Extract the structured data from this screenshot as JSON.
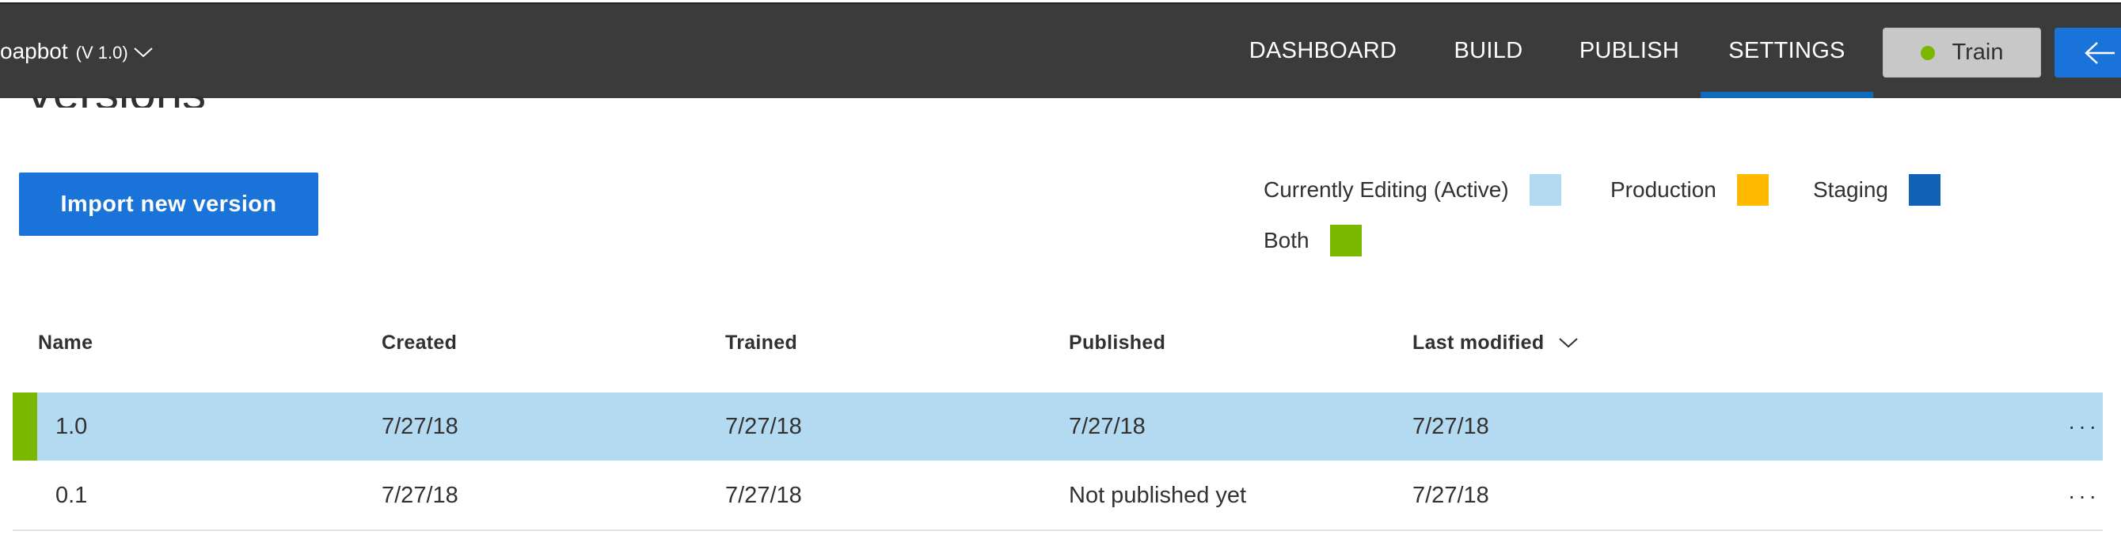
{
  "header": {
    "app_name": "oapbot",
    "version": "(V 1.0)",
    "tabs": [
      {
        "label": "DASHBOARD",
        "active": false
      },
      {
        "label": "BUILD",
        "active": false
      },
      {
        "label": "PUBLISH",
        "active": false
      },
      {
        "label": "SETTINGS",
        "active": true
      }
    ],
    "train_label": "Train",
    "train_status_color": "#7ab800",
    "accent_color": "#1a73d9"
  },
  "page": {
    "title": "Versions",
    "import_button": "Import new version"
  },
  "legend": [
    {
      "label": "Currently Editing (Active)",
      "color": "#b3daf1"
    },
    {
      "label": "Production",
      "color": "#ffb900"
    },
    {
      "label": "Staging",
      "color": "#0f62b5"
    },
    {
      "label": "Both",
      "color": "#7ab800"
    }
  ],
  "table": {
    "columns": [
      "Name",
      "Created",
      "Trained",
      "Published",
      "Last modified"
    ],
    "sorted_column": "Last modified",
    "rows": [
      {
        "name": "1.0",
        "created": "7/27/18",
        "trained": "7/27/18",
        "published": "7/27/18",
        "last_modified": "7/27/18",
        "state": "Both (Active)"
      },
      {
        "name": "0.1",
        "created": "7/27/18",
        "trained": "7/27/18",
        "published": "Not published yet",
        "last_modified": "7/27/18",
        "state": ""
      }
    ],
    "more_label": "···"
  }
}
